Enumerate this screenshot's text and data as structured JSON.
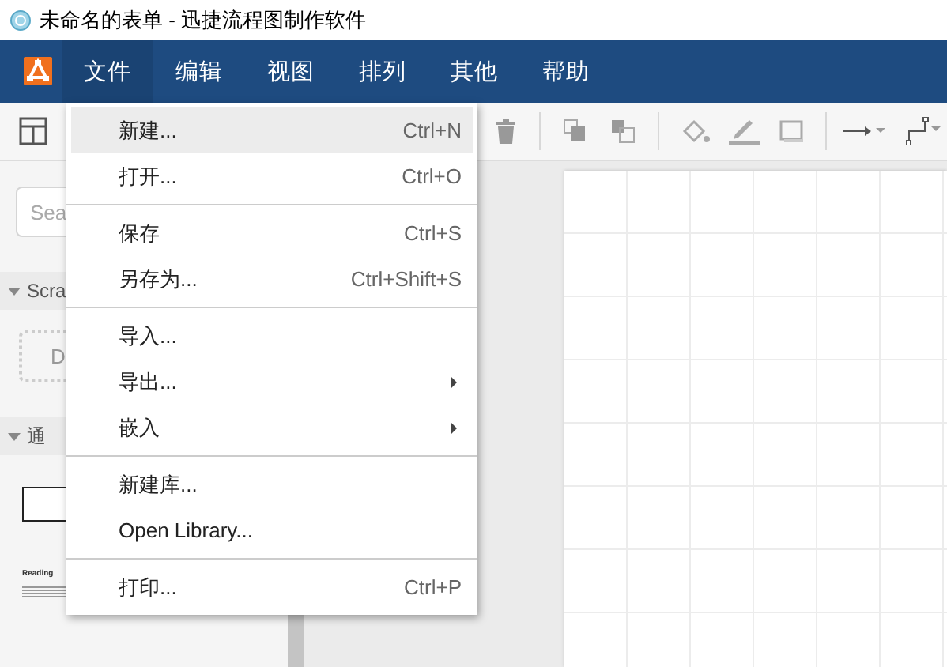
{
  "window": {
    "title": "未命名的表单 - 迅捷流程图制作软件"
  },
  "menubar": {
    "items": [
      {
        "label": "文件",
        "selected": true
      },
      {
        "label": "编辑",
        "selected": false
      },
      {
        "label": "视图",
        "selected": false
      },
      {
        "label": "排列",
        "selected": false
      },
      {
        "label": "其他",
        "selected": false
      },
      {
        "label": "帮助",
        "selected": false
      }
    ]
  },
  "sidebar": {
    "search": {
      "placeholder": "Sea"
    },
    "sections": [
      {
        "title": "Scra",
        "expanded": true,
        "kind": "scratchpad",
        "drop_hint": "D"
      },
      {
        "title": "通",
        "expanded": true,
        "kind": "shapes",
        "thumbnail_caption": "Reading"
      }
    ]
  },
  "file_menu": {
    "groups": [
      [
        {
          "label": "新建...",
          "shortcut": "Ctrl+N",
          "submenu": false,
          "selected": true
        },
        {
          "label": "打开...",
          "shortcut": "Ctrl+O",
          "submenu": false,
          "selected": false
        }
      ],
      [
        {
          "label": "保存",
          "shortcut": "Ctrl+S",
          "submenu": false,
          "selected": false
        },
        {
          "label": "另存为...",
          "shortcut": "Ctrl+Shift+S",
          "submenu": false,
          "selected": false
        }
      ],
      [
        {
          "label": "导入...",
          "submenu": false,
          "selected": false
        },
        {
          "label": "导出...",
          "submenu": true,
          "selected": false
        },
        {
          "label": "嵌入",
          "submenu": true,
          "selected": false
        }
      ],
      [
        {
          "label": "新建库...",
          "submenu": false,
          "selected": false
        },
        {
          "label": "Open Library...",
          "submenu": false,
          "selected": false
        }
      ],
      [
        {
          "label": "打印...",
          "shortcut": "Ctrl+P",
          "submenu": false,
          "selected": false
        }
      ]
    ]
  }
}
